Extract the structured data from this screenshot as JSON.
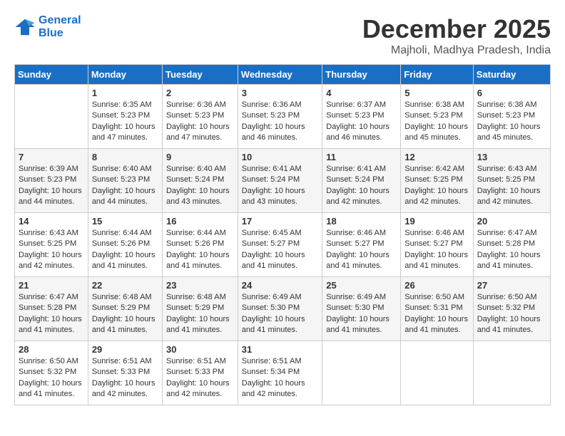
{
  "logo": {
    "line1": "General",
    "line2": "Blue"
  },
  "title": "December 2025",
  "location": "Majholi, Madhya Pradesh, India",
  "days_of_week": [
    "Sunday",
    "Monday",
    "Tuesday",
    "Wednesday",
    "Thursday",
    "Friday",
    "Saturday"
  ],
  "weeks": [
    [
      {
        "day": "",
        "sunrise": "",
        "sunset": "",
        "daylight": ""
      },
      {
        "day": "1",
        "sunrise": "Sunrise: 6:35 AM",
        "sunset": "Sunset: 5:23 PM",
        "daylight": "Daylight: 10 hours and 47 minutes."
      },
      {
        "day": "2",
        "sunrise": "Sunrise: 6:36 AM",
        "sunset": "Sunset: 5:23 PM",
        "daylight": "Daylight: 10 hours and 47 minutes."
      },
      {
        "day": "3",
        "sunrise": "Sunrise: 6:36 AM",
        "sunset": "Sunset: 5:23 PM",
        "daylight": "Daylight: 10 hours and 46 minutes."
      },
      {
        "day": "4",
        "sunrise": "Sunrise: 6:37 AM",
        "sunset": "Sunset: 5:23 PM",
        "daylight": "Daylight: 10 hours and 46 minutes."
      },
      {
        "day": "5",
        "sunrise": "Sunrise: 6:38 AM",
        "sunset": "Sunset: 5:23 PM",
        "daylight": "Daylight: 10 hours and 45 minutes."
      },
      {
        "day": "6",
        "sunrise": "Sunrise: 6:38 AM",
        "sunset": "Sunset: 5:23 PM",
        "daylight": "Daylight: 10 hours and 45 minutes."
      }
    ],
    [
      {
        "day": "7",
        "sunrise": "Sunrise: 6:39 AM",
        "sunset": "Sunset: 5:23 PM",
        "daylight": "Daylight: 10 hours and 44 minutes."
      },
      {
        "day": "8",
        "sunrise": "Sunrise: 6:40 AM",
        "sunset": "Sunset: 5:23 PM",
        "daylight": "Daylight: 10 hours and 44 minutes."
      },
      {
        "day": "9",
        "sunrise": "Sunrise: 6:40 AM",
        "sunset": "Sunset: 5:24 PM",
        "daylight": "Daylight: 10 hours and 43 minutes."
      },
      {
        "day": "10",
        "sunrise": "Sunrise: 6:41 AM",
        "sunset": "Sunset: 5:24 PM",
        "daylight": "Daylight: 10 hours and 43 minutes."
      },
      {
        "day": "11",
        "sunrise": "Sunrise: 6:41 AM",
        "sunset": "Sunset: 5:24 PM",
        "daylight": "Daylight: 10 hours and 42 minutes."
      },
      {
        "day": "12",
        "sunrise": "Sunrise: 6:42 AM",
        "sunset": "Sunset: 5:25 PM",
        "daylight": "Daylight: 10 hours and 42 minutes."
      },
      {
        "day": "13",
        "sunrise": "Sunrise: 6:43 AM",
        "sunset": "Sunset: 5:25 PM",
        "daylight": "Daylight: 10 hours and 42 minutes."
      }
    ],
    [
      {
        "day": "14",
        "sunrise": "Sunrise: 6:43 AM",
        "sunset": "Sunset: 5:25 PM",
        "daylight": "Daylight: 10 hours and 42 minutes."
      },
      {
        "day": "15",
        "sunrise": "Sunrise: 6:44 AM",
        "sunset": "Sunset: 5:26 PM",
        "daylight": "Daylight: 10 hours and 41 minutes."
      },
      {
        "day": "16",
        "sunrise": "Sunrise: 6:44 AM",
        "sunset": "Sunset: 5:26 PM",
        "daylight": "Daylight: 10 hours and 41 minutes."
      },
      {
        "day": "17",
        "sunrise": "Sunrise: 6:45 AM",
        "sunset": "Sunset: 5:27 PM",
        "daylight": "Daylight: 10 hours and 41 minutes."
      },
      {
        "day": "18",
        "sunrise": "Sunrise: 6:46 AM",
        "sunset": "Sunset: 5:27 PM",
        "daylight": "Daylight: 10 hours and 41 minutes."
      },
      {
        "day": "19",
        "sunrise": "Sunrise: 6:46 AM",
        "sunset": "Sunset: 5:27 PM",
        "daylight": "Daylight: 10 hours and 41 minutes."
      },
      {
        "day": "20",
        "sunrise": "Sunrise: 6:47 AM",
        "sunset": "Sunset: 5:28 PM",
        "daylight": "Daylight: 10 hours and 41 minutes."
      }
    ],
    [
      {
        "day": "21",
        "sunrise": "Sunrise: 6:47 AM",
        "sunset": "Sunset: 5:28 PM",
        "daylight": "Daylight: 10 hours and 41 minutes."
      },
      {
        "day": "22",
        "sunrise": "Sunrise: 6:48 AM",
        "sunset": "Sunset: 5:29 PM",
        "daylight": "Daylight: 10 hours and 41 minutes."
      },
      {
        "day": "23",
        "sunrise": "Sunrise: 6:48 AM",
        "sunset": "Sunset: 5:29 PM",
        "daylight": "Daylight: 10 hours and 41 minutes."
      },
      {
        "day": "24",
        "sunrise": "Sunrise: 6:49 AM",
        "sunset": "Sunset: 5:30 PM",
        "daylight": "Daylight: 10 hours and 41 minutes."
      },
      {
        "day": "25",
        "sunrise": "Sunrise: 6:49 AM",
        "sunset": "Sunset: 5:30 PM",
        "daylight": "Daylight: 10 hours and 41 minutes."
      },
      {
        "day": "26",
        "sunrise": "Sunrise: 6:50 AM",
        "sunset": "Sunset: 5:31 PM",
        "daylight": "Daylight: 10 hours and 41 minutes."
      },
      {
        "day": "27",
        "sunrise": "Sunrise: 6:50 AM",
        "sunset": "Sunset: 5:32 PM",
        "daylight": "Daylight: 10 hours and 41 minutes."
      }
    ],
    [
      {
        "day": "28",
        "sunrise": "Sunrise: 6:50 AM",
        "sunset": "Sunset: 5:32 PM",
        "daylight": "Daylight: 10 hours and 41 minutes."
      },
      {
        "day": "29",
        "sunrise": "Sunrise: 6:51 AM",
        "sunset": "Sunset: 5:33 PM",
        "daylight": "Daylight: 10 hours and 42 minutes."
      },
      {
        "day": "30",
        "sunrise": "Sunrise: 6:51 AM",
        "sunset": "Sunset: 5:33 PM",
        "daylight": "Daylight: 10 hours and 42 minutes."
      },
      {
        "day": "31",
        "sunrise": "Sunrise: 6:51 AM",
        "sunset": "Sunset: 5:34 PM",
        "daylight": "Daylight: 10 hours and 42 minutes."
      },
      {
        "day": "",
        "sunrise": "",
        "sunset": "",
        "daylight": ""
      },
      {
        "day": "",
        "sunrise": "",
        "sunset": "",
        "daylight": ""
      },
      {
        "day": "",
        "sunrise": "",
        "sunset": "",
        "daylight": ""
      }
    ]
  ]
}
